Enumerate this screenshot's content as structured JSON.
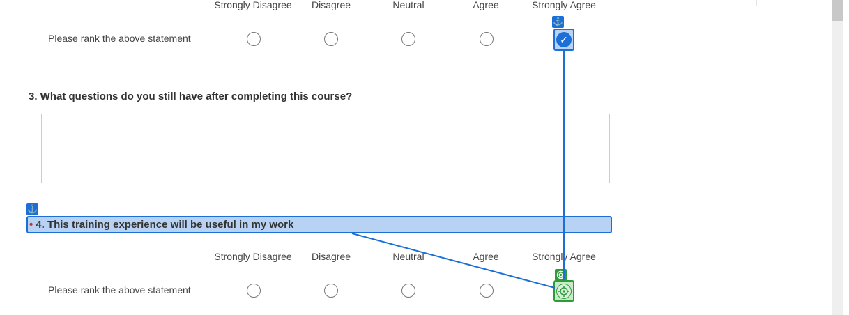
{
  "scale": {
    "labels": [
      "Strongly Disagree",
      "Disagree",
      "Neutral",
      "Agree",
      "Strongly Agree"
    ]
  },
  "question2": {
    "row_label": "Please rank the above statement",
    "selected": "Strongly Agree"
  },
  "question3": {
    "title": "3. What questions do you still have after completing this course?",
    "answer_placeholder": ""
  },
  "question4": {
    "required_marker": "•",
    "title": "4. This training experience will be useful in my work",
    "row_label": "Please rank the above statement"
  },
  "icons": {
    "anchor": "⚓",
    "check": "✓"
  },
  "colors": {
    "accent_blue": "#1b6fd6",
    "highlight_blue": "#b7d2f3",
    "target_green": "#2c9b3a",
    "required_red": "#c0313b"
  }
}
